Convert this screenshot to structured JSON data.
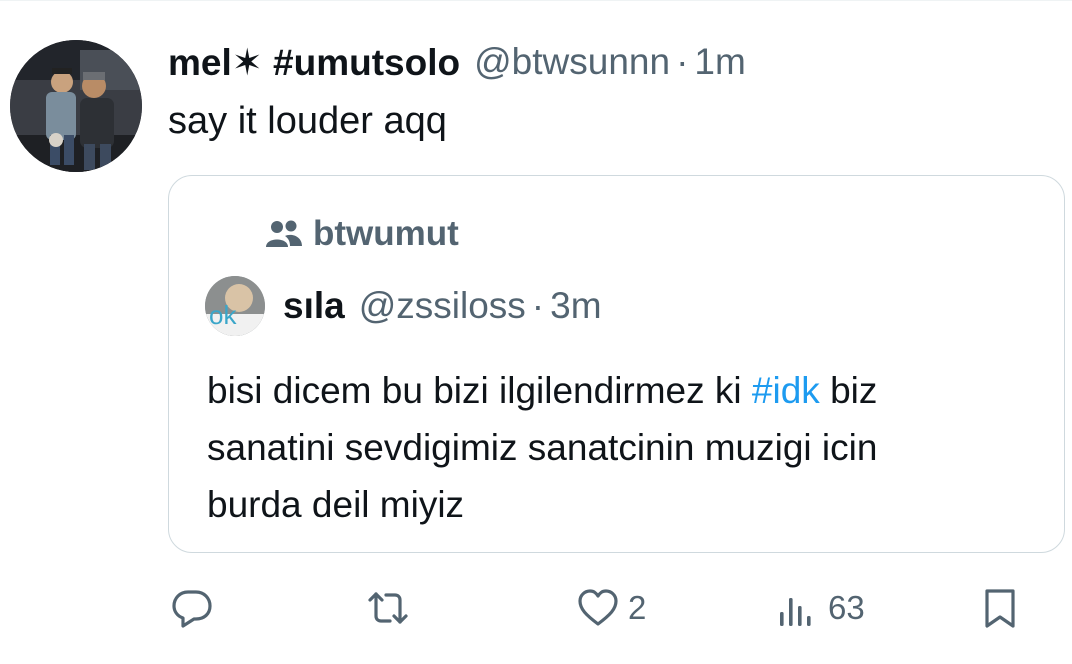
{
  "tweet": {
    "display_name": "mel✶ #umutsolo",
    "handle": "@btwsunnn",
    "separator": "·",
    "time": "1m",
    "text": "say it louder aqq"
  },
  "quote": {
    "community": "btwumut",
    "avatar_text": "ok",
    "display_name": "sıla",
    "handle": "@zssiloss",
    "separator": "·",
    "time": "3m",
    "text_line1_before": "bisi dicem bu bizi ilgilendirmez ki ",
    "hashtag": "#idk",
    "text_line1_after": " biz",
    "text_line2": "sanatini sevdigimiz sanatcinin muzigi icin",
    "text_line3": "burda deil miyiz"
  },
  "actions": {
    "reply_count": "",
    "retweet_count": "",
    "like_count": "2",
    "views_count": "63"
  },
  "colors": {
    "text": "#0f1419",
    "secondary": "#536471",
    "link": "#1d9bf0",
    "border": "#cfd9de"
  },
  "icons": [
    "reply-icon",
    "retweet-icon",
    "heart-icon",
    "views-icon",
    "bookmark-icon",
    "community-icon"
  ]
}
